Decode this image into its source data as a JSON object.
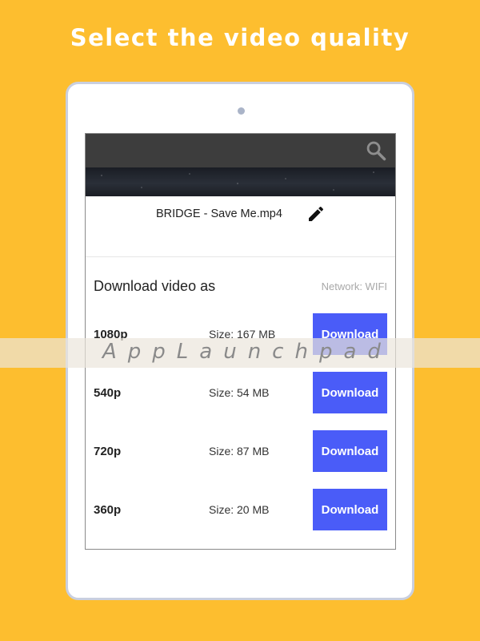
{
  "headline": "Select the video quality",
  "colors": {
    "background": "#FDBE2F",
    "accent": "#4a5cf8",
    "appbar": "#3d3d3d"
  },
  "icons": {
    "search": "search-icon",
    "edit": "pencil-icon"
  },
  "file": {
    "name": "BRIDGE - Save Me.mp4"
  },
  "download_panel": {
    "title": "Download video as",
    "network": "Network: WIFI",
    "options": [
      {
        "quality": "1080p",
        "size": "Size: 167 MB",
        "button": "Download"
      },
      {
        "quality": "540p",
        "size": "Size: 54 MB",
        "button": "Download"
      },
      {
        "quality": "720p",
        "size": "Size: 87 MB",
        "button": "Download"
      },
      {
        "quality": "360p",
        "size": "Size: 20 MB",
        "button": "Download"
      }
    ]
  },
  "watermark": "AppLaunchpad"
}
